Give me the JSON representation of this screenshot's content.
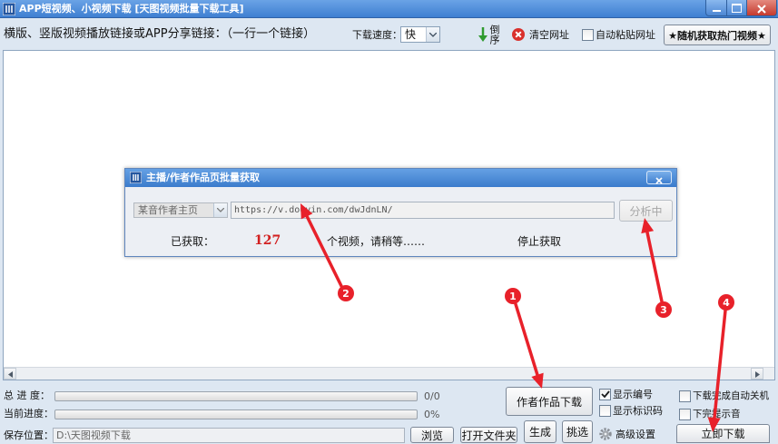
{
  "window": {
    "title": "APP短视频、小视频下载 [天图视频批量下载工具]"
  },
  "toolbar": {
    "link_label": "横版、竖版视频播放链接或APP分享链接：（一行一个链接）",
    "speed_label": "下载速度：",
    "speed_value": "快",
    "reverse_label": "倒序",
    "clear_label": "清空网址",
    "auto_paste_label": "自动粘贴网址",
    "auto_paste_checked": false,
    "hot_videos_button": "★随机获取热门视频★"
  },
  "dialog": {
    "title": "主播/作者作品页批量获取",
    "source_select": "某音作者主页",
    "url_value": "https://v.douyin.com/dwJdnLN/",
    "analyze_button": "分析中",
    "fetched_label": "已获取：",
    "fetched_count": "127",
    "status_text": "个视频，请稍等……",
    "stop_label": "停止获取"
  },
  "progress": {
    "total_label": "总 进 度：",
    "total_text": "0/0",
    "total_fraction": 0,
    "current_label": "当前进度：",
    "current_text": "0%",
    "current_fraction": 0
  },
  "save": {
    "label": "保存位置：",
    "path": "D:\\天图视频下载",
    "browse_button": "浏览",
    "open_folder_button": "打开文件夹",
    "generate_button": "生成",
    "pick_button": "挑选",
    "advanced_settings": "高级设置"
  },
  "options": {
    "author_download_button": "作者作品下载",
    "show_number_label": "显示编号",
    "show_number_checked": true,
    "show_id_label": "显示标识码",
    "show_id_checked": false,
    "auto_shutdown_label": "下载完成自动关机",
    "auto_shutdown_checked": false,
    "sound_label": "下完提示音",
    "sound_checked": false,
    "download_now_button": "立即下载"
  },
  "annotations": [
    "1",
    "2",
    "3",
    "4"
  ],
  "colors": {
    "title_bar": "#3f7fd1",
    "annotation_red": "#e8212a",
    "count_red": "#d21f1f",
    "panel_bg": "#dde7f2"
  },
  "icons": [
    "app-icon",
    "minimize-icon",
    "maximize-icon",
    "close-icon",
    "chevron-down-icon",
    "green-down-arrow-icon",
    "red-clear-icon",
    "gear-icon",
    "check-icon",
    "scroll-left-icon",
    "scroll-right-icon"
  ]
}
